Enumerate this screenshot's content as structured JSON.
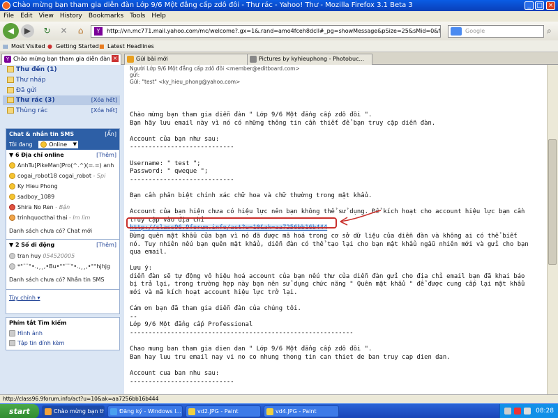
{
  "window": {
    "title": "Chào mừng bạn tham gia diễn đàn Lớp 9/6 Một đẳng cấp zdô đôi - Thư rác - Yahoo! Thư - Mozilla Firefox 3.1 Beta 3"
  },
  "menu": [
    "File",
    "Edit",
    "View",
    "History",
    "Bookmarks",
    "Tools",
    "Help"
  ],
  "nav": {
    "url": "http://vn.mc771.mail.yahoo.com/mc/welcome?.gx=1&.rand=amo4fceh8dcll#_pg=showMessage&pSize=25&sMid=0&fid=%25",
    "search_placeholder": "Google"
  },
  "bookmarks": [
    "Most Visited",
    "Getting Started",
    "Latest Headlines"
  ],
  "tabs": [
    {
      "label": "Chào mừng bạn tham gia diễn đàn ..."
    },
    {
      "label": "Gửi bài mới"
    },
    {
      "label": "Pictures by kyhieuphong - Photobuc..."
    }
  ],
  "sidebar": {
    "folders": [
      {
        "label": "Thư đến (1)"
      },
      {
        "label": "Thư nháp"
      },
      {
        "label": "Đã gửi"
      },
      {
        "label": "Thư rác (3)"
      },
      {
        "label": "Thùng rác"
      }
    ],
    "clear_label": "[Xóa hết]",
    "chat": {
      "title": "Chat & nhắn tin SMS",
      "hide": "[Ẩn]",
      "status_label": "Tôi đang",
      "status_value": "Online",
      "group1": "6 Địa chỉ online",
      "add": "[Thêm]",
      "contacts": [
        {
          "name": "AnhTu[PikeMan]Pro(^.^)(=.=) anh",
          "status": ""
        },
        {
          "name": "cogai_robot18 cogai_robot",
          "status": "- Spi"
        },
        {
          "name": "Ky Hieu Phong",
          "status": ""
        },
        {
          "name": "sadboy_1089",
          "status": ""
        },
        {
          "name": "Shira No Ren",
          "status": "- Bận"
        },
        {
          "name": "trinhquocthai thai",
          "status": "- Im lìm"
        }
      ],
      "missing1": "Danh sách chưa có? Chat mới",
      "group2": "2 Số di động",
      "mobiles": [
        {
          "name": "tran huy",
          "status": "054520005"
        },
        {
          "name": "*°¨¨°•.,¸¸,•Bu•°°¨¨°•.,¸¸,•°°hjhjg",
          "status": ""
        }
      ],
      "missing2": "Danh sách chưa có? Nhắn tin SMS",
      "options": "Tùy chỉnh ▾"
    },
    "shortcuts": {
      "title": "Phím tắt Tìm kiếm",
      "items": [
        "Hình ảnh",
        "Tập tin đính kèm"
      ]
    }
  },
  "message": {
    "from_line": "Người   Lớp 9/6 Một đẳng cấp zdô đôi  <member@editboard.com>",
    "from_sub": "gửi:",
    "to_line": "Gửi:    \"test\" <ky_hieu_phong@yahoo.com>",
    "body_top": "Chào mừng bạn tham gia diễn đàn \" Lớp 9/6 Một đẳng cấp zdô đôi \".\nBạn hãy lưu email này vì nó có những thông tin cần thiết để bạn truy cập diễn đàn.\n\nAccount của bạn như sau:\n----------------------------\n\nUsername: \" test \";\nPassword: \" qweque \";\n----------------------------\n\nBạn cần phân biệt chính xác chữ hoa và chữ thường trong mật khẩu.\n\nAccount của bạn hiện chưa có hiệu lực nên bạn không thể sử dụng. Để kích hoạt cho account hiệu lực bạn cần\ntruy cập vào địa chỉ\n",
    "activation_link": "http://class96.9forum.info/act?u=10&ak=aa7256bb16b444",
    "body_bottom": "\nĐừng quên mật khẩu của bạn vì nó đã được mã hoá trong cơ sở dữ liệu của diễn đàn và không ai có thể biết\nnó. Tuy nhiên nếu bạn quên mật khẩu, diễn đàn có thể tạo lại cho bạn mật khẩu ngẫu nhiên mới và gửi cho bạn\nqua email.\n\nLưu ý:\ndiễn đàn sẽ tự động vô hiệu hoá account của bạn nếu thư của diễn đàn gửi cho địa chỉ email bạn đã khai báo\nbị trả lại, trong trường hợp này bạn nên sử dụng chức năng \" Quên mật khẩu \" để được cung cấp lại mật khẩu\nmới và mã kích hoạt account hiệu lực trở lại.\n\nCám ơn bạn đã tham gia diễn đàn của chúng tôi.\n--\nLớp 9/6 Một đẳng cấp Professional\n------------------------------------------------------------\n\nChao mung ban tham gia dien dan \" Lớp 9/6 Một đẳng cấp zdô đôi \".\nBan hay luu tru email nay vi no co nhung thong tin can thiet de ban truy cap dien dan.\n\nAccount cua ban nhu sau:\n----------------------------"
  },
  "status_bar": "http://class96.9forum.info/act?u=10&ak=aa7256bb16b444",
  "taskbar": {
    "start": "start",
    "tasks": [
      "Chào mừng bạn tha...",
      "Đăng ký - Windows I...",
      "vd2.JPG - Paint",
      "vd4.JPG - Paint"
    ],
    "clock": "08:28"
  }
}
